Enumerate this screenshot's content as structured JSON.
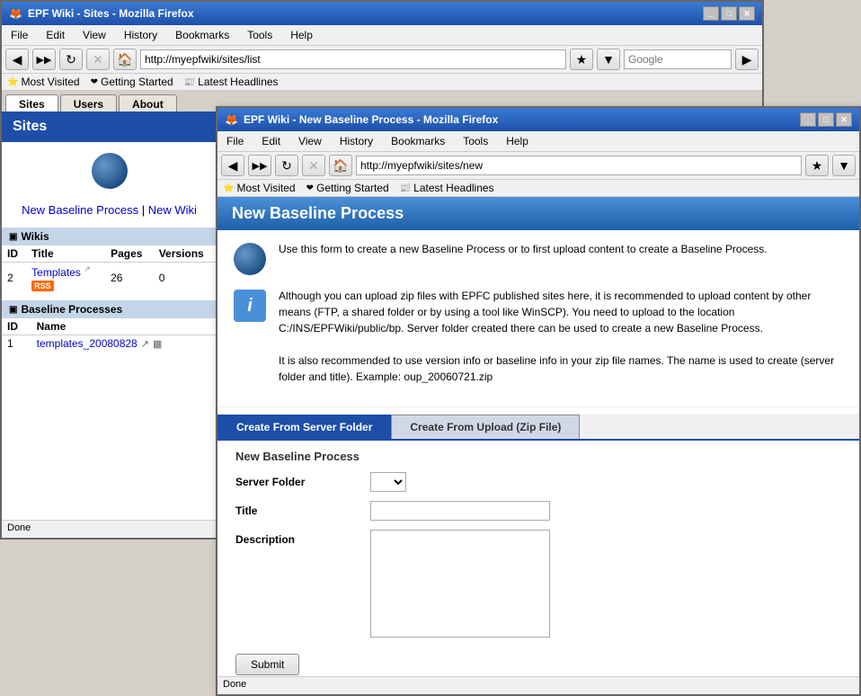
{
  "browser1": {
    "title": "EPF Wiki - Sites - Mozilla Firefox",
    "url": "http://myepfwiki/sites/list",
    "menu": [
      "File",
      "Edit",
      "View",
      "History",
      "Bookmarks",
      "Tools",
      "Help"
    ],
    "bookmarks": [
      "Most Visited",
      "Getting Started",
      "Latest Headlines"
    ],
    "search_placeholder": "Google",
    "tabs": [
      "Sites",
      "Users",
      "About"
    ],
    "active_tab": "Sites",
    "sidebar": {
      "header": "Sites",
      "links": {
        "new_baseline": "New Baseline Process",
        "new_wiki": "New Wiki",
        "separator": "|"
      },
      "wikis_section": "Wikis",
      "wikis_columns": [
        "ID",
        "Title",
        "Pages",
        "Versions"
      ],
      "wikis_rows": [
        {
          "id": "2",
          "title": "Templates",
          "pages": "26",
          "versions": "0"
        }
      ],
      "baseline_section": "Baseline Processes",
      "baseline_columns": [
        "ID",
        "Name"
      ],
      "baseline_rows": [
        {
          "id": "1",
          "name": "templates_20080828"
        }
      ]
    },
    "status": "Done"
  },
  "browser2": {
    "title": "EPF Wiki - New Baseline Process - Mozilla Firefox",
    "url": "http://myepfwiki/sites/new",
    "menu": [
      "File",
      "Edit",
      "View",
      "History",
      "Bookmarks",
      "Tools",
      "Help"
    ],
    "bookmarks": [
      "Most Visited",
      "Getting Started",
      "Latest Headlines"
    ],
    "page_title": "New Baseline Process",
    "info_text": "Use this form to create a new Baseline Process or to first upload content to create a Baseline Process.",
    "detail_text1": "Although you can upload zip files with EPFC published sites here, it is recommended to upload content by other means (FTP, a shared folder or by using a tool like WinSCP). You need to upload to the location C:/INS/EPFWiki/public/bp. Server folder created there can be used to create a new Baseline Process.",
    "detail_text2": "It is also recommended to use version info or baseline info in your zip file names. The name is used to create (server folder and title). Example: oup_20060721.zip",
    "tabs": [
      {
        "label": "Create From Server Folder",
        "active": true
      },
      {
        "label": "Create From Upload (Zip File)",
        "active": false
      }
    ],
    "form_subtitle": "New Baseline Process",
    "fields": {
      "server_folder_label": "Server Folder",
      "title_label": "Title",
      "description_label": "Description"
    },
    "submit_label": "Submit",
    "status": "Done"
  }
}
